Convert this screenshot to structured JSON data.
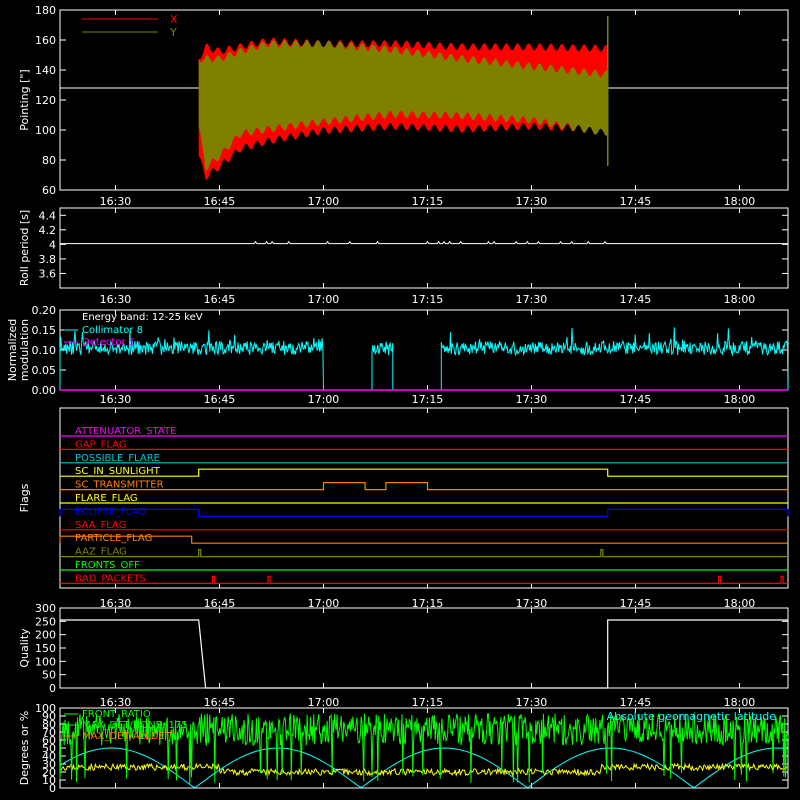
{
  "x_ticks": [
    "16:30",
    "16:45",
    "17:00",
    "17:15",
    "17:30",
    "17:45",
    "18:00"
  ],
  "colors": {
    "axis": "#ffffff",
    "x": "#ff0000",
    "y": "#808000",
    "collimator": "#00ffff",
    "magenta": "#ff00ff",
    "yellow": "#ffff00",
    "green": "#00ff00",
    "orange": "#ff8000",
    "blue": "#0000ff",
    "cyan": "#00c8c8",
    "red": "#ff0000",
    "olive": "#808000"
  },
  "chart_data": [
    {
      "type": "area",
      "ylabel": "Pointing [\"]",
      "ylim": [
        60,
        180
      ],
      "yticks": [
        60,
        80,
        100,
        120,
        140,
        160,
        180
      ],
      "xlim": [
        "16:22",
        "18:07"
      ],
      "legend": [
        "X",
        "Y"
      ],
      "reference_line": 128,
      "series": [
        {
          "name": "X",
          "x": [
            "16:42",
            "16:43",
            "16:45",
            "16:48",
            "16:52",
            "17:00",
            "17:10",
            "17:20",
            "17:30",
            "17:40",
            "17:41"
          ],
          "min": [
            80,
            66,
            73,
            85,
            90,
            97,
            100,
            98,
            100,
            98,
            98
          ],
          "max": [
            150,
            158,
            155,
            158,
            162,
            160,
            160,
            158,
            158,
            157,
            157
          ]
        },
        {
          "name": "Y",
          "x": [
            "16:42",
            "16:43",
            "16:45",
            "16:48",
            "16:52",
            "17:00",
            "17:10",
            "17:20",
            "17:30",
            "17:40",
            "17:41"
          ],
          "min": [
            100,
            72,
            80,
            95,
            98,
            103,
            108,
            107,
            104,
            96,
            96
          ],
          "max": [
            150,
            150,
            150,
            155,
            160,
            160,
            156,
            150,
            145,
            140,
            140
          ]
        }
      ]
    },
    {
      "type": "line",
      "ylabel": "Roll period [s]",
      "ylim": [
        3.4,
        4.5
      ],
      "yticks": [
        3.6,
        3.8,
        4.0,
        4.2,
        4.4
      ],
      "series": [
        {
          "name": "",
          "x": [
            "16:22",
            "18:07"
          ],
          "values": [
            4.01,
            4.01
          ]
        }
      ]
    },
    {
      "type": "line",
      "ylabel": "Normalized modulation",
      "ylim": [
        0.0,
        0.2
      ],
      "yticks": [
        "0.00",
        "0.05",
        "0.10",
        "0.15",
        "0.20"
      ],
      "annotations": [
        "Energy band: 12-25 keV"
      ],
      "legend": [
        "Collimator 8",
        "Detector 1"
      ],
      "series": [
        {
          "name": "Collimator 8",
          "segments": [
            [
              "16:22",
              "17:00",
              0.105
            ],
            [
              "17:07",
              "17:10",
              0.105
            ],
            [
              "17:17",
              "18:07",
              0.105
            ]
          ],
          "level": 0.105
        },
        {
          "name": "Detector 1",
          "x": [
            "16:22",
            "18:07"
          ],
          "values": [
            0.0,
            0.0
          ]
        }
      ]
    },
    {
      "type": "line",
      "ylabel": "Flags",
      "flags": [
        {
          "name": "ATTENUATOR_STATE",
          "color": "magenta",
          "high": []
        },
        {
          "name": "GAP_FLAG",
          "color": "red",
          "high": []
        },
        {
          "name": "POSSIBLE_FLARE",
          "color": "cyan",
          "high": []
        },
        {
          "name": "SC_IN_SUNLIGHT",
          "color": "yellow",
          "high": [
            [
              "16:42",
              "17:41"
            ]
          ]
        },
        {
          "name": "SC_TRANSMITTER",
          "color": "orange",
          "high": [
            [
              "17:00",
              "17:06"
            ],
            [
              "17:09",
              "17:15"
            ]
          ]
        },
        {
          "name": "FLARE_FLAG",
          "color": "yellow",
          "high": []
        },
        {
          "name": "ECLIPSE_FLAG",
          "color": "blue",
          "high": [
            [
              "16:22",
              "16:42"
            ],
            [
              "17:41",
              "18:07"
            ]
          ]
        },
        {
          "name": "SAA_FLAG",
          "color": "red",
          "high": []
        },
        {
          "name": "PARTICLE_FLAG",
          "color": "orange",
          "high": [
            [
              "16:22",
              "16:41"
            ]
          ]
        },
        {
          "name": "AAZ_FLAG",
          "color": "olive",
          "high": [
            [
              "16:42",
              "16:42"
            ],
            [
              "17:40",
              "17:40"
            ]
          ]
        },
        {
          "name": "FRONTS_OFF",
          "color": "green",
          "high": []
        },
        {
          "name": "BAD_PACKETS",
          "color": "red",
          "high": [
            [
              "16:44",
              "16:44"
            ],
            [
              "16:52",
              "16:52"
            ],
            [
              "17:57",
              "17:57"
            ],
            [
              "18:06",
              "18:06"
            ]
          ]
        }
      ]
    },
    {
      "type": "line",
      "ylabel": "Quality",
      "ylim": [
        0,
        300
      ],
      "yticks": [
        0,
        50,
        100,
        150,
        200,
        250,
        300
      ],
      "series": [
        {
          "name": "",
          "x": [
            "16:22",
            "16:42",
            "16:43",
            "17:41",
            "17:41",
            "18:07"
          ],
          "values": [
            255,
            255,
            0,
            0,
            255,
            255
          ]
        }
      ]
    },
    {
      "type": "line",
      "ylabel": "Degrees or %",
      "ylim": [
        0,
        100
      ],
      "yticks": [
        0,
        10,
        20,
        30,
        40,
        50,
        60,
        70,
        80,
        90,
        100
      ],
      "legend": [
        "FRONT_RATIO",
        "MAX_DET/NONE: 175",
        "MAX_DET/ALLDET"
      ],
      "annotations": [
        "Absolute geomagnetic latitude"
      ],
      "series": [
        {
          "name": "FRONT_RATIO",
          "approx_level": 25
        },
        {
          "name": "MAX_DET/NONE: 175",
          "approx_level": 40
        },
        {
          "name": "MAX_DET/ALLDET",
          "approx_level": 75
        },
        {
          "name": "Absolute geomagnetic latitude",
          "approx_range": [
            0,
            50
          ]
        }
      ]
    }
  ]
}
